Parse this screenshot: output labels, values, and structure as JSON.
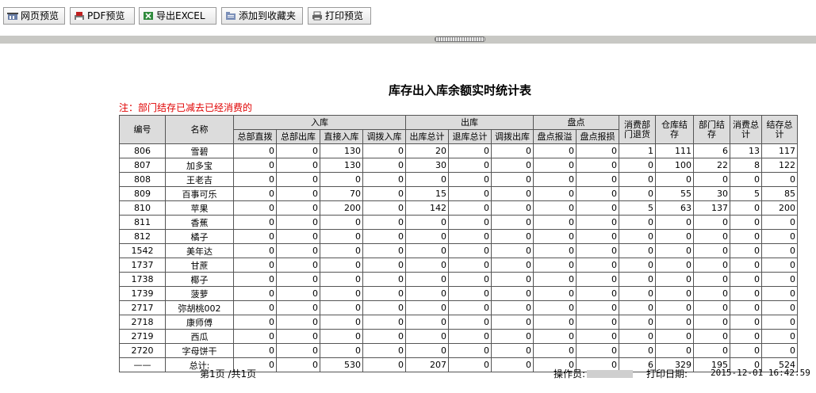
{
  "toolbar": {
    "buttons": [
      {
        "label": "网页预览",
        "icon": "web-preview-icon"
      },
      {
        "label": "PDF预览",
        "icon": "pdf-icon"
      },
      {
        "label": "导出EXCEL",
        "icon": "excel-icon"
      },
      {
        "label": "添加到收藏夹",
        "icon": "favorites-icon"
      },
      {
        "label": "打印预览",
        "icon": "printer-icon"
      }
    ]
  },
  "report": {
    "title": "库存出入库余额实时统计表",
    "note": "注：部门结存已减去已经消费的",
    "headers": {
      "id": "编号",
      "name": "名称",
      "inbound": "入库",
      "outbound": "出库",
      "inventory": "盘点",
      "consume_return": "消费部门退货",
      "warehouse_balance": "仓库结存",
      "dept_balance": "部门结存",
      "consume_total": "消费总计",
      "balance_total": "结存总计",
      "sub": [
        "总部直拨",
        "总部出库",
        "直接入库",
        "调拨入库",
        "出库总计",
        "退库总计",
        "调拨出库",
        "盘点报溢",
        "盘点报损"
      ]
    },
    "rows": [
      [
        "806",
        "雪碧",
        "0",
        "0",
        "130",
        "0",
        "20",
        "0",
        "0",
        "0",
        "0",
        "1",
        "111",
        "6",
        "13",
        "117"
      ],
      [
        "807",
        "加多宝",
        "0",
        "0",
        "130",
        "0",
        "30",
        "0",
        "0",
        "0",
        "0",
        "0",
        "100",
        "22",
        "8",
        "122"
      ],
      [
        "808",
        "王老吉",
        "0",
        "0",
        "0",
        "0",
        "0",
        "0",
        "0",
        "0",
        "0",
        "0",
        "0",
        "0",
        "0",
        "0"
      ],
      [
        "809",
        "百事可乐",
        "0",
        "0",
        "70",
        "0",
        "15",
        "0",
        "0",
        "0",
        "0",
        "0",
        "55",
        "30",
        "5",
        "85"
      ],
      [
        "810",
        "苹果",
        "0",
        "0",
        "200",
        "0",
        "142",
        "0",
        "0",
        "0",
        "0",
        "5",
        "63",
        "137",
        "0",
        "200"
      ],
      [
        "811",
        "香蕉",
        "0",
        "0",
        "0",
        "0",
        "0",
        "0",
        "0",
        "0",
        "0",
        "0",
        "0",
        "0",
        "0",
        "0"
      ],
      [
        "812",
        "橘子",
        "0",
        "0",
        "0",
        "0",
        "0",
        "0",
        "0",
        "0",
        "0",
        "0",
        "0",
        "0",
        "0",
        "0"
      ],
      [
        "1542",
        "美年达",
        "0",
        "0",
        "0",
        "0",
        "0",
        "0",
        "0",
        "0",
        "0",
        "0",
        "0",
        "0",
        "0",
        "0"
      ],
      [
        "1737",
        "甘蔗",
        "0",
        "0",
        "0",
        "0",
        "0",
        "0",
        "0",
        "0",
        "0",
        "0",
        "0",
        "0",
        "0",
        "0"
      ],
      [
        "1738",
        "椰子",
        "0",
        "0",
        "0",
        "0",
        "0",
        "0",
        "0",
        "0",
        "0",
        "0",
        "0",
        "0",
        "0",
        "0"
      ],
      [
        "1739",
        "菠萝",
        "0",
        "0",
        "0",
        "0",
        "0",
        "0",
        "0",
        "0",
        "0",
        "0",
        "0",
        "0",
        "0",
        "0"
      ],
      [
        "2717",
        "弥胡桃002",
        "0",
        "0",
        "0",
        "0",
        "0",
        "0",
        "0",
        "0",
        "0",
        "0",
        "0",
        "0",
        "0",
        "0"
      ],
      [
        "2718",
        "康师傅",
        "0",
        "0",
        "0",
        "0",
        "0",
        "0",
        "0",
        "0",
        "0",
        "0",
        "0",
        "0",
        "0",
        "0"
      ],
      [
        "2719",
        "西瓜",
        "0",
        "0",
        "0",
        "0",
        "0",
        "0",
        "0",
        "0",
        "0",
        "0",
        "0",
        "0",
        "0",
        "0"
      ],
      [
        "2720",
        "字母饼干",
        "0",
        "0",
        "0",
        "0",
        "0",
        "0",
        "0",
        "0",
        "0",
        "0",
        "0",
        "0",
        "0",
        "0"
      ]
    ],
    "total_row": [
      "——",
      "总计:",
      "0",
      "0",
      "530",
      "0",
      "207",
      "0",
      "0",
      "0",
      "0",
      "6",
      "329",
      "195",
      "0",
      "524"
    ]
  },
  "footer": {
    "page": "第1页 /共1页",
    "operator_label": "操作员:",
    "print_date_label": "打印日期:",
    "print_date": "2015-12-01 16:42:59"
  }
}
